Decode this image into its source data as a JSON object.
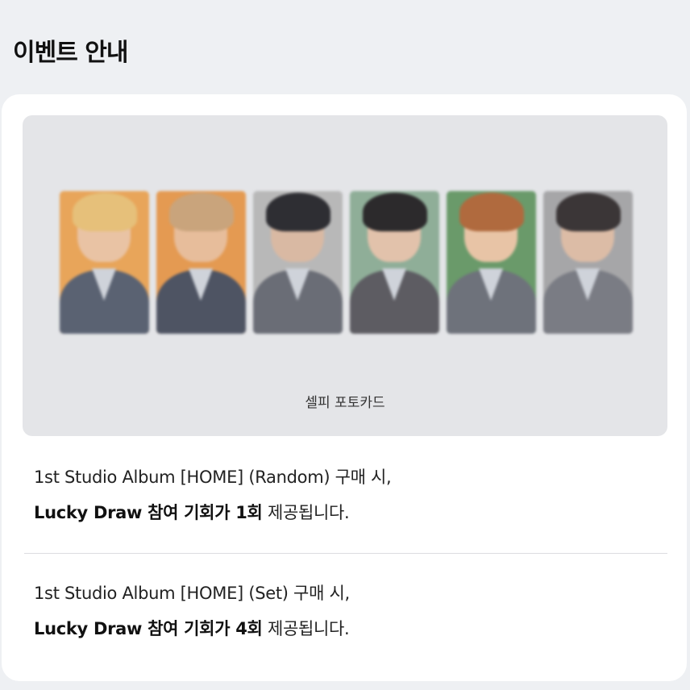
{
  "page": {
    "title": "이벤트 안내"
  },
  "banner": {
    "caption": "셀피 포토카드",
    "photocards": [
      {
        "name": "photocard-1",
        "bg": "#e8a55a",
        "hair": "#e6c07a",
        "face": "#e9c3a4",
        "suit": "#5a6272"
      },
      {
        "name": "photocard-2",
        "bg": "#e49a52",
        "hair": "#c9a47c",
        "face": "#e7bd9b",
        "suit": "#4e5463"
      },
      {
        "name": "photocard-3",
        "bg": "#b8b8b8",
        "hair": "#2e2e33",
        "face": "#d9b9a3",
        "suit": "#6a6d76"
      },
      {
        "name": "photocard-4",
        "bg": "#8fae98",
        "hair": "#2c2a2c",
        "face": "#e2c2ab",
        "suit": "#5d5c62"
      },
      {
        "name": "photocard-5",
        "bg": "#6a9a6a",
        "hair": "#b06a3e",
        "face": "#e8c4a6",
        "suit": "#6e727b"
      },
      {
        "name": "photocard-6",
        "bg": "#a6a6a8",
        "hair": "#3b3637",
        "face": "#dcbca6",
        "suit": "#7a7c84"
      }
    ]
  },
  "info": [
    {
      "line1": "1st Studio Album [HOME] (Random) 구매 시,",
      "bold": "Lucky Draw 참여 기회가 1회",
      "rest": " 제공됩니다."
    },
    {
      "line1": "1st Studio Album [HOME] (Set) 구매 시,",
      "bold": "Lucky Draw 참여 기회가 4회",
      "rest": " 제공됩니다."
    }
  ],
  "colors": {
    "background": "#eef0f3",
    "card": "#ffffff",
    "banner": "#e4e5e8",
    "divider": "#dcdde0"
  }
}
